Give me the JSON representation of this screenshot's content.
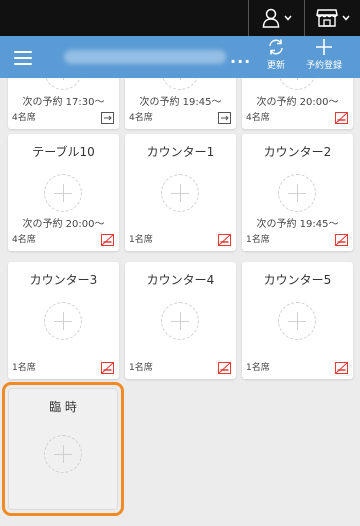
{
  "header": {
    "ellipsis": "...",
    "refresh_label": "更新",
    "reserve_label": "予約登録"
  },
  "top_row": [
    {
      "next": "次の予約 17:30～",
      "seats": "4名席",
      "badge": "split"
    },
    {
      "next": "次の予約 19:45～",
      "seats": "4名席",
      "badge": "split"
    },
    {
      "next": "次の予約 20:00～",
      "seats": "4名席",
      "badge": "no-smoking"
    }
  ],
  "tables": [
    {
      "name": "テーブル10",
      "next": "次の予約 20:00～",
      "seats": "4名席",
      "badge": "no-smoking"
    },
    {
      "name": "カウンター1",
      "next": "",
      "seats": "1名席",
      "badge": "no-smoking"
    },
    {
      "name": "カウンター2",
      "next": "次の予約 19:45～",
      "seats": "1名席",
      "badge": "no-smoking"
    },
    {
      "name": "カウンター3",
      "next": "",
      "seats": "1名席",
      "badge": "no-smoking"
    },
    {
      "name": "カウンター4",
      "next": "",
      "seats": "1名席",
      "badge": "no-smoking"
    },
    {
      "name": "カウンター5",
      "next": "",
      "seats": "1名席",
      "badge": "no-smoking"
    }
  ],
  "temporary": {
    "name": "臨 時"
  },
  "colors": {
    "header_bg": "#5b9bd5",
    "accent_orange": "#f08a24",
    "badge_red": "#e53935"
  }
}
